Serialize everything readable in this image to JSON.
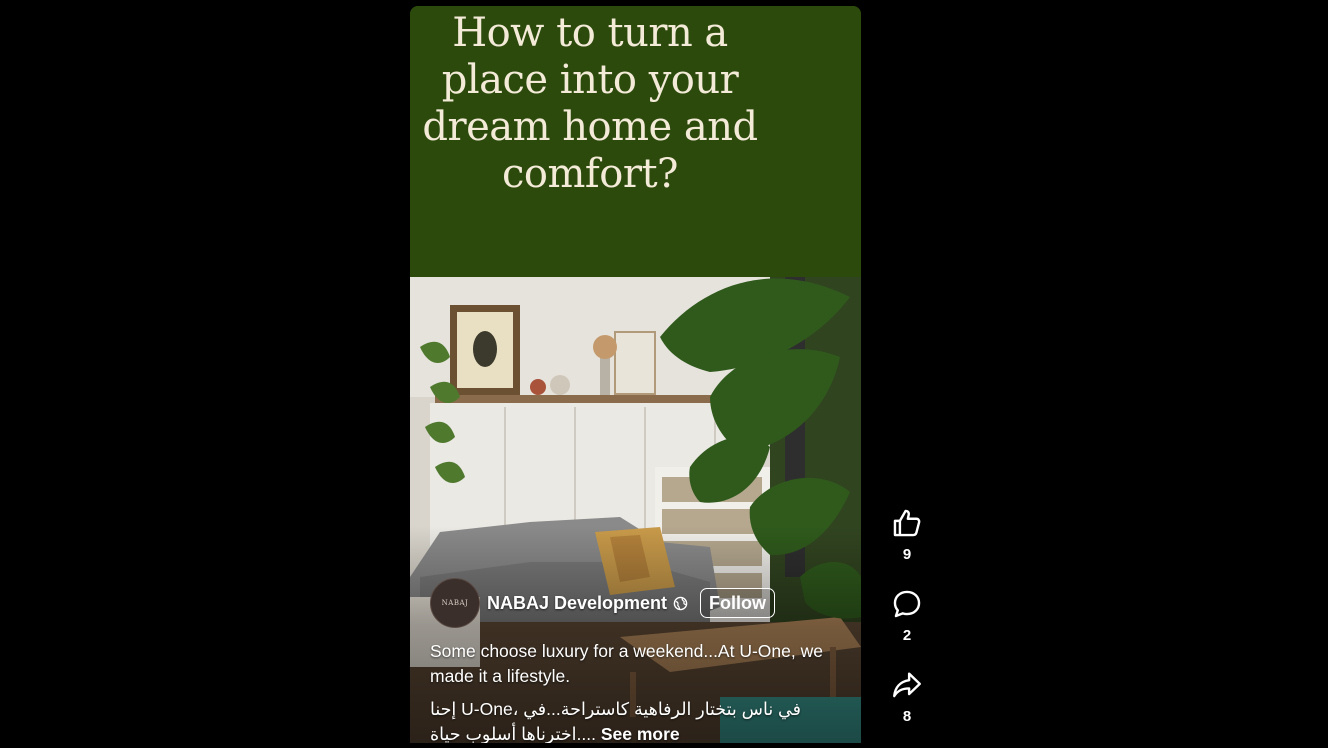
{
  "video": {
    "headline": "How to turn a place into your dream home and comfort?",
    "background_color": "#2c4a0c",
    "headline_color": "#f3ead8"
  },
  "author": {
    "avatar_text": "NABAJ",
    "name": "NABAJ Development",
    "visibility_icon": "globe-icon",
    "follow_label": "Follow"
  },
  "caption": {
    "english": "Some choose luxury for a weekend...At U-One, we made it a lifestyle.",
    "arabic": "إحنا U-One، في ناس بتختار الرفاهية كاستراحة...في اخترناها أسلوب حياة....",
    "see_more": "See more"
  },
  "actions": [
    {
      "icon": "thumbs-up-icon",
      "count": "9"
    },
    {
      "icon": "comment-icon",
      "count": "2"
    },
    {
      "icon": "share-icon",
      "count": "8"
    }
  ]
}
